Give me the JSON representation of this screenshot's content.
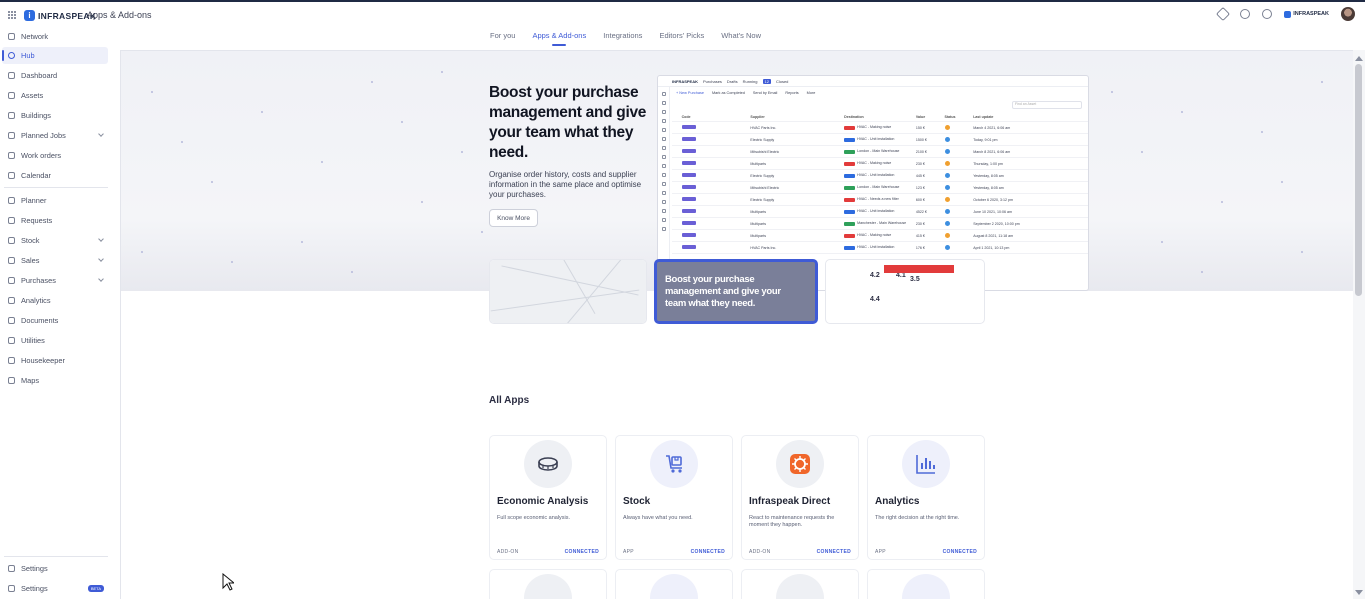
{
  "header": {
    "brand": "INFRASPEAK",
    "title": "Apps & Add-ons",
    "org_name": "INFRASPEAK"
  },
  "tabs": [
    {
      "label": "For you"
    },
    {
      "label": "Apps & Add-ons"
    },
    {
      "label": "Integrations"
    },
    {
      "label": "Editors' Picks"
    },
    {
      "label": "What's Now"
    }
  ],
  "sidebar": {
    "items": [
      {
        "label": "Network",
        "icon": "network-icon"
      },
      {
        "label": "Hub",
        "icon": "hub-icon"
      },
      {
        "label": "Dashboard",
        "icon": "dashboard-icon"
      },
      {
        "label": "Assets",
        "icon": "assets-icon"
      },
      {
        "label": "Buildings",
        "icon": "buildings-icon"
      },
      {
        "label": "Planned Jobs",
        "icon": "planned-jobs-icon"
      },
      {
        "label": "Work orders",
        "icon": "work-orders-icon"
      },
      {
        "label": "Calendar",
        "icon": "calendar-icon"
      },
      {
        "label": "Planner",
        "icon": "planner-icon"
      },
      {
        "label": "Requests",
        "icon": "requests-icon"
      },
      {
        "label": "Stock",
        "icon": "stock-icon"
      },
      {
        "label": "Sales",
        "icon": "sales-icon"
      },
      {
        "label": "Purchases",
        "icon": "purchases-icon"
      },
      {
        "label": "Analytics",
        "icon": "analytics-icon"
      },
      {
        "label": "Documents",
        "icon": "documents-icon"
      },
      {
        "label": "Utilities",
        "icon": "utilities-icon"
      },
      {
        "label": "Housekeeper",
        "icon": "housekeeper-icon"
      },
      {
        "label": "Maps",
        "icon": "maps-icon"
      }
    ],
    "footer": [
      {
        "label": "Settings"
      },
      {
        "label": "Settings",
        "badge": "BETA"
      }
    ]
  },
  "hero": {
    "title": "Boost your purchase management and give your team what they need.",
    "description": "Organise order history, costs and supplier information in the same place and optimise your purchases.",
    "button": "Know More",
    "mockup": {
      "brand": "INFRASPEAK",
      "section": "Purchases",
      "filters": [
        "Drafts",
        "Running",
        "Closed"
      ],
      "running_count": "12",
      "toolbar": [
        "+ New Purchase",
        "Mark as Completed",
        "Send by Email",
        "Reports",
        "More"
      ],
      "search_placeholder": "Find an Asset",
      "columns": [
        "Code",
        "Supplier",
        "Destination",
        "Value",
        "Status",
        "Last update"
      ],
      "rows": [
        {
          "supplier": "HVAC Parts Inc.",
          "destination": "HVAC - Making noise",
          "value": "150 €",
          "updated": "March 4 2021, 6:06 am",
          "tag": "#e23b3b",
          "status": "#f0a030"
        },
        {
          "supplier": "Electric Supply",
          "destination": "HVAC - Unit installation",
          "value": "1500 €",
          "updated": "Today, 9:01 pm",
          "tag": "#2d6bdf",
          "status": "#3d8fe0"
        },
        {
          "supplier": "Mitsubishi Electric",
          "destination": "London - Main Warehouse",
          "value": "2100 €",
          "updated": "March 8 2021, 6:06 am",
          "tag": "#2ea05a",
          "status": "#3d8fe0"
        },
        {
          "supplier": "Multiparts",
          "destination": "HVAC - Making noise",
          "value": "230 €",
          "updated": "Thursday, 1:00 pm",
          "tag": "#e23b3b",
          "status": "#f0a030"
        },
        {
          "supplier": "Electric Supply",
          "destination": "HVAC - Unit installation",
          "value": "445 €",
          "updated": "Yesterday, 8:05 am",
          "tag": "#2d6bdf",
          "status": "#3d8fe0"
        },
        {
          "supplier": "Mitsubishi Electric",
          "destination": "London - Main Warehouse",
          "value": "123 €",
          "updated": "Yesterday, 8:05 am",
          "tag": "#2ea05a",
          "status": "#3d8fe0"
        },
        {
          "supplier": "Electric Supply",
          "destination": "HVAC - Needs a new filter",
          "value": "600 €",
          "updated": "October 6 2020, 3:12 pm",
          "tag": "#e23b3b",
          "status": "#f0a030"
        },
        {
          "supplier": "Multiparts",
          "destination": "HVAC - Unit installation",
          "value": "4522 €",
          "updated": "June 10 2021, 10:06 am",
          "tag": "#2d6bdf",
          "status": "#3d8fe0"
        },
        {
          "supplier": "Multiparts",
          "destination": "Manchester - Main Warehouse",
          "value": "230 €",
          "updated": "September 2 2020, 10:00 pm",
          "tag": "#2ea05a",
          "status": "#3d8fe0"
        },
        {
          "supplier": "Multiparts",
          "destination": "HVAC - Making noise",
          "value": "415 €",
          "updated": "August 8 2021, 11:18 am",
          "tag": "#e23b3b",
          "status": "#f0a030"
        },
        {
          "supplier": "HVAC Parts Inc.",
          "destination": "HVAC - Unit installation",
          "value": "176 €",
          "updated": "April 1 2021, 10:13 pm",
          "tag": "#2d6bdf",
          "status": "#3d8fe0"
        }
      ]
    }
  },
  "carousel": {
    "slide_text": "Boost your purchase management and give your team what they need.",
    "kpis": [
      "4.2",
      "3.5",
      "4.4",
      "4.1"
    ]
  },
  "all_apps": {
    "title": "All Apps",
    "cards": [
      {
        "name": "Economic Analysis",
        "description": "Full scope economic analysis.",
        "type": "ADD-ON",
        "status": "CONNECTED",
        "icon": "coins-icon",
        "bg": "#eef0f4"
      },
      {
        "name": "Stock",
        "description": "Always have what you need.",
        "type": "APP",
        "status": "CONNECTED",
        "icon": "stock-box-icon",
        "bg": "#eef0fb"
      },
      {
        "name": "Infraspeak Direct",
        "description": "React to maintenance requests the moment they happen.",
        "type": "ADD-ON",
        "status": "CONNECTED",
        "icon": "direct-icon",
        "bg": "#eef0f4"
      },
      {
        "name": "Analytics",
        "description": "The right decision at the right time.",
        "type": "APP",
        "status": "CONNECTED",
        "icon": "bar-chart-icon",
        "bg": "#eef0fb"
      }
    ]
  },
  "colors": {
    "accent": "#3f5bd6",
    "brand": "#2d6bdf",
    "direct_orange": "#f0662a"
  }
}
